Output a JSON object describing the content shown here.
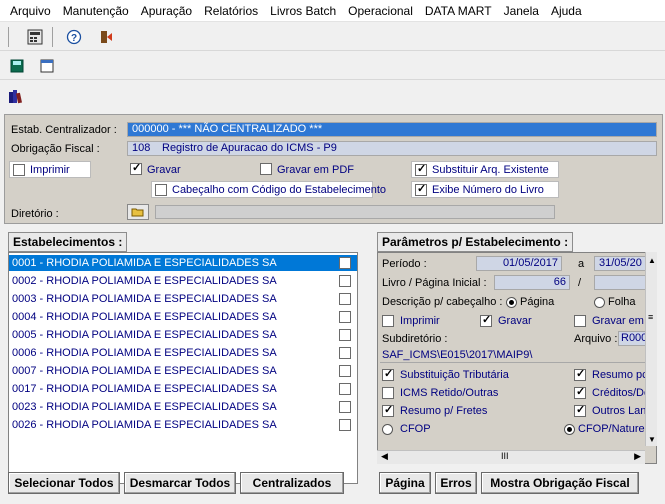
{
  "menu": [
    "Arquivo",
    "Manutenção",
    "Apuração",
    "Relatórios",
    "Livros Batch",
    "Operacional",
    "DATA MART",
    "Janela",
    "Ajuda"
  ],
  "icons": [
    "calculator-icon",
    "help-icon",
    "exit-door-icon",
    "save-icon",
    "window-icon",
    "books-icon"
  ],
  "form": {
    "estab_label": "Estab. Centralizador :",
    "estab_value": "000000 - *** NÃO CENTRALIZADO ***",
    "obrig_label": "Obrigação Fiscal :",
    "obrig_code": "108",
    "obrig_desc": "Registro de Apuracao do ICMS - P9",
    "imprimir": "Imprimir",
    "gravar": "Gravar",
    "gravar_pdf": "Gravar em PDF",
    "substituir": "Substituir Arq. Existente",
    "cabecalho": "Cabeçalho com Código do Estabelecimento",
    "exibe_numero": "Exibe Número do Livro",
    "diretorio": "Diretório :"
  },
  "estab": {
    "header": "Estabelecimentos :",
    "rows": [
      "0001 - RHODIA POLIAMIDA E ESPECIALIDADES SA",
      "0002 - RHODIA POLIAMIDA E ESPECIALIDADES SA",
      "0003 - RHODIA POLIAMIDA E ESPECIALIDADES SA",
      "0004 - RHODIA POLIAMIDA E ESPECIALIDADES SA",
      "0005 - RHODIA POLIAMIDA E ESPECIALIDADES SA",
      "0006 - RHODIA POLIAMIDA E ESPECIALIDADES SA",
      "0007 - RHODIA POLIAMIDA E ESPECIALIDADES SA",
      "0017 - RHODIA POLIAMIDA E ESPECIALIDADES SA",
      "0023 - RHODIA POLIAMIDA E ESPECIALIDADES SA",
      "0026 - RHODIA POLIAMIDA E ESPECIALIDADES SA"
    ],
    "selected_index": 0
  },
  "params": {
    "header": "Parâmetros p/ Estabelecimento :",
    "periodo_label": "Período :",
    "periodo_ini": "01/05/2017",
    "periodo_a": "a",
    "periodo_fim": "31/05/20",
    "livro_label": "Livro / Página Inicial :",
    "livro_value": "66",
    "slash": "/",
    "descricao_label": "Descrição p/ cabeçalho :",
    "pagina": "Página",
    "folha": "Folha",
    "imprimir": "Imprimir",
    "gravar": "Gravar",
    "gravar_em": "Gravar em",
    "subdir_label": "Subdiretório :",
    "arquivo_label": "Arquivo :",
    "arquivo_value": "R000",
    "path": "SAF_ICMS\\E015\\2017\\MAIP9\\",
    "subst_trib": "Substituição Tributária",
    "resumo_p": "Resumo pc",
    "icms_retido": "ICMS Retido/Outras",
    "creditos": "Créditos/De",
    "resumo_fretes": "Resumo p/ Fretes",
    "outros_lan": "Outros Lan",
    "cfop": "CFOP",
    "cfop_nat": "CFOP/Naturez",
    "scroll_mid": "III"
  },
  "buttons": {
    "selecionar": "Selecionar Todos",
    "desmarcar": "Desmarcar Todos",
    "centralizados": "Centralizados",
    "pagina": "Página",
    "erros": "Erros",
    "mostra": "Mostra Obrigação Fiscal"
  },
  "colors": {
    "selection": "#0078d7",
    "link_text": "#000080",
    "panel": "#d4d0c8"
  }
}
